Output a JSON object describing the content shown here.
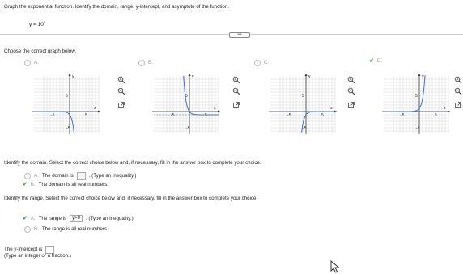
{
  "question": {
    "instruction": "Graph the exponential function. Identify the domain, range, y-intercept, and asymptote of the function.",
    "equation_base": "y = 10",
    "equation_exp": "x"
  },
  "graph_section": {
    "prompt": "Choose the correct graph below.",
    "options": [
      {
        "letter": "A.",
        "selected": false
      },
      {
        "letter": "B.",
        "selected": false
      },
      {
        "letter": "C.",
        "selected": false
      },
      {
        "letter": "D.",
        "selected": true
      }
    ],
    "axis": {
      "x_label": "x",
      "y_label": "y",
      "tick_pos": "5",
      "tick_neg": "-5"
    }
  },
  "domain_section": {
    "prompt": "Identify the domain. Select the correct choice below and, if necessary, fill in the answer box to complete your choice.",
    "choice_a_letter": "A.",
    "choice_a_pre": "The domain is",
    "choice_a_post": ". (Type an inequality.)",
    "choice_b_letter": "B.",
    "choice_b_text": "The domain is all real numbers."
  },
  "range_section": {
    "prompt": "Identify the range. Select the correct choice below and, if necessary, fill in the answer box to complete your choice.",
    "choice_a_letter": "A.",
    "choice_a_pre": "The range is",
    "choice_a_answer": "y>0",
    "choice_a_post": ". (Type an inequality.)",
    "choice_b_letter": "B.",
    "choice_b_text": "The range is all real numbers."
  },
  "intercept_section": {
    "prompt": "The y-intercept is",
    "hint": "(Type an integer or a fraction.)"
  },
  "colors": {
    "check": "#3aa34a",
    "curve": "#3a6fd0",
    "asymptote": "#3a6fd0",
    "grid": "#cccccc"
  }
}
